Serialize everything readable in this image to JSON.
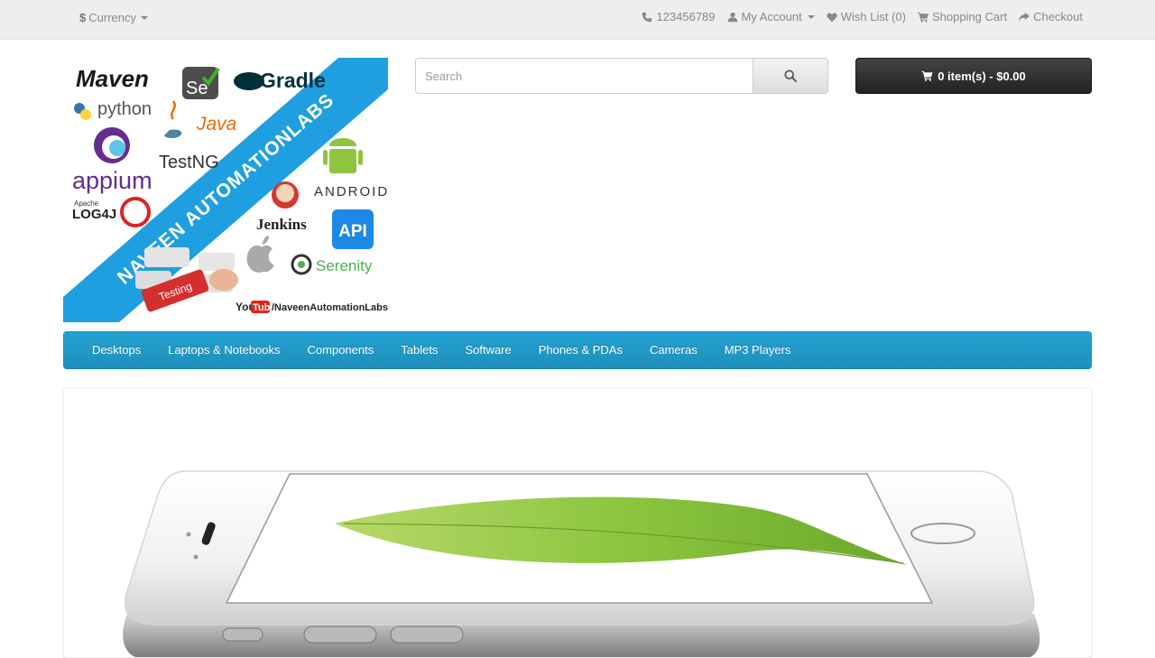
{
  "topbar": {
    "currency_symbol": "$",
    "currency_label": "Currency",
    "phone": "123456789",
    "my_account": "My Account",
    "wish_list": "Wish List (0)",
    "shopping_cart": "Shopping Cart",
    "checkout": "Checkout"
  },
  "logo": {
    "banner_text": "NAVEEN AUTOMATIONLABS",
    "key_text": "Testing",
    "tools": [
      "Maven",
      "Se",
      "Gradle",
      "python",
      "Java",
      "appium",
      "TestNG",
      "ANDROID",
      "Apache",
      "LOG4J",
      "Jenkins",
      "API",
      "Serenity"
    ],
    "youtube_label": "You",
    "youtube_tube": "Tube",
    "youtube_path": "/NaveenAutomationLabs"
  },
  "search": {
    "placeholder": "Search",
    "value": ""
  },
  "cart": {
    "label": "0 item(s) - $0.00"
  },
  "menu": {
    "items": [
      "Desktops",
      "Laptops & Notebooks",
      "Components",
      "Tablets",
      "Software",
      "Phones & PDAs",
      "Cameras",
      "MP3 Players"
    ]
  },
  "colors": {
    "menu_blue": "#229ac8",
    "logo_banner": "#1f9fe0",
    "cart_bg": "#303030"
  }
}
